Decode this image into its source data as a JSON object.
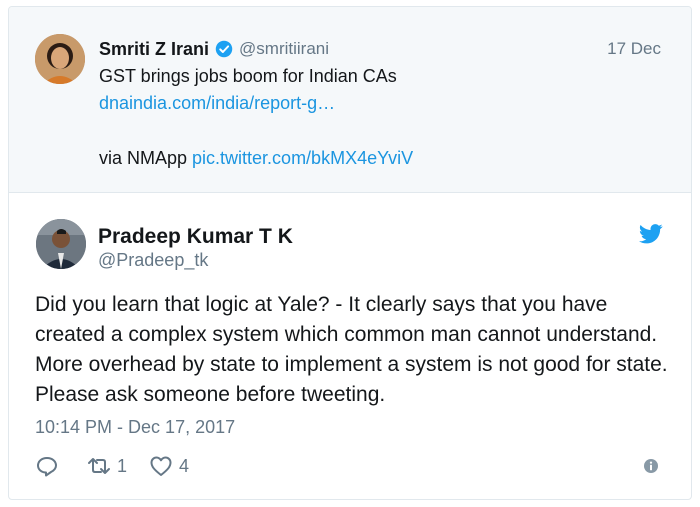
{
  "parent_tweet": {
    "author_name": "Smriti Z Irani",
    "handle": "@smritiirani",
    "date": "17 Dec",
    "text": "GST brings jobs boom for Indian CAs",
    "link": "dnaindia.com/india/report-g…",
    "via_prefix": "via NMApp",
    "pic_link": "pic.twitter.com/bkMX4eYviV",
    "icons": {
      "verified": "verified-badge-icon"
    }
  },
  "reply_tweet": {
    "author_name": "Pradeep Kumar T K",
    "handle": "@Pradeep_tk",
    "text": "Did you learn that logic at Yale? - It clearly says that you have created a complex system which common man cannot understand. More overhead by state to implement a system is not good for state. Please ask someone before tweeting.",
    "timestamp": "10:14 PM - Dec 17, 2017",
    "retweet_count": "1",
    "like_count": "4",
    "icons": {
      "logo": "twitter-bird-icon",
      "reply": "reply-icon",
      "retweet": "retweet-icon",
      "like": "heart-icon",
      "info": "info-icon"
    }
  },
  "colors": {
    "link": "#1b95e0",
    "muted": "#657786",
    "parent_background": "#f5f8fa",
    "twitter_blue": "#1da1f2"
  }
}
